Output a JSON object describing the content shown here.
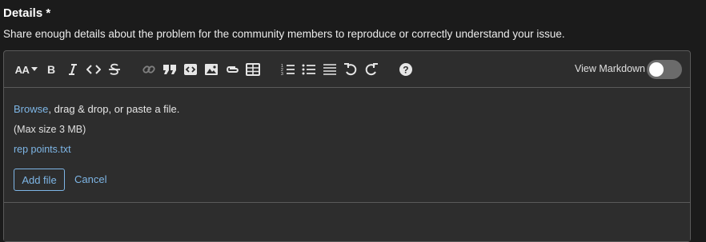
{
  "field": {
    "title": "Details *",
    "description": "Share enough details about the problem for the community members to reproduce or correctly understand your issue."
  },
  "toolbar": {
    "heading_label": "AA",
    "icons": [
      "heading-icon",
      "bold-icon",
      "italic-icon",
      "code-icon",
      "strikethrough-icon",
      "link-icon",
      "quote-icon",
      "code-block-icon",
      "image-icon",
      "attachment-icon",
      "table-icon",
      "ordered-list-icon",
      "unordered-list-icon",
      "horizontal-rule-icon",
      "undo-icon",
      "redo-icon",
      "help-icon"
    ],
    "view_markdown_label": "View Markdown",
    "view_markdown_on": false
  },
  "upload": {
    "browse_label": "Browse",
    "instructions": ", drag & drop, or paste a file.",
    "max_size": "(Max size 3 MB)",
    "file_name": "rep points.txt",
    "add_file_label": "Add file",
    "cancel_label": "Cancel"
  },
  "colors": {
    "background": "#1b1b1b",
    "panel": "#2d2d2d",
    "border": "#5a5a5a",
    "link": "#7eb6e6",
    "toggle_off": "#6b6b6b"
  }
}
